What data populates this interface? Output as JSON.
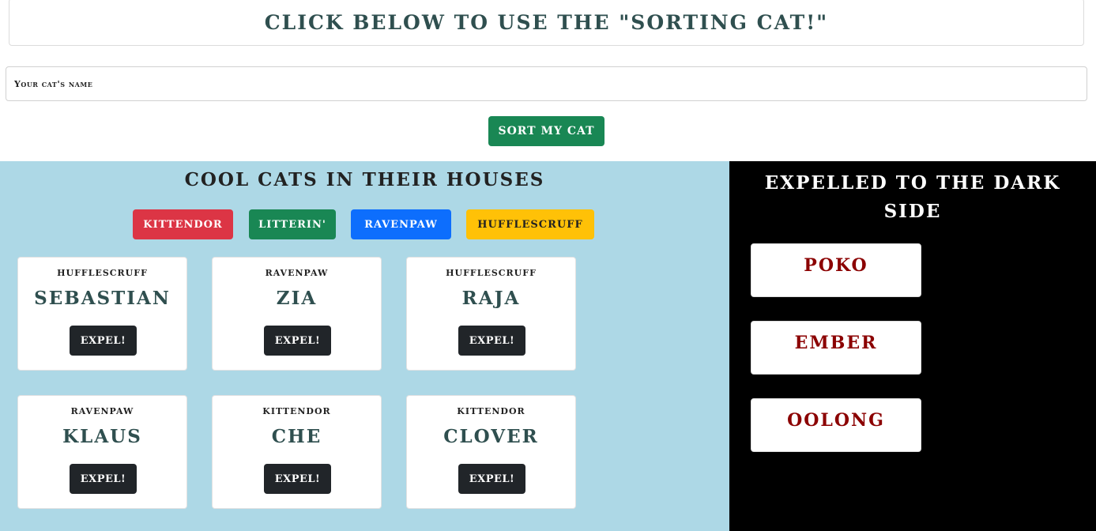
{
  "banner": {
    "title": "Click below to use the \"Sorting Cat!\""
  },
  "form": {
    "name_placeholder": "Your cat's name",
    "sort_label": "Sort my cat"
  },
  "houses": {
    "title": "Cool cats in their houses",
    "filters": [
      {
        "label": "Kittendor",
        "color": "#dc3545"
      },
      {
        "label": "Litterin'",
        "color": "#198754"
      },
      {
        "label": "Ravenpaw",
        "color": "#0d6efd"
      },
      {
        "label": "Hufflescruff",
        "color": "#ffc107"
      }
    ],
    "cats": [
      {
        "house": "Hufflescruff",
        "name": "Sebastian",
        "action": "Expel!"
      },
      {
        "house": "Ravenpaw",
        "name": "Zia",
        "action": "Expel!"
      },
      {
        "house": "Hufflescruff",
        "name": "Raja",
        "action": "Expel!"
      },
      {
        "house": "Ravenpaw",
        "name": "Klaus",
        "action": "Expel!"
      },
      {
        "house": "Kittendor",
        "name": "Che",
        "action": "Expel!"
      },
      {
        "house": "Kittendor",
        "name": "Clover",
        "action": "Expel!"
      }
    ]
  },
  "dark_side": {
    "title": "Expelled to the dark side",
    "expelled": [
      {
        "name": "Poko"
      },
      {
        "name": "Ember"
      },
      {
        "name": "Oolong"
      }
    ]
  },
  "colors": {
    "houses_bg": "#add8e6",
    "dark_bg": "#000000",
    "expelled_text": "#8b0000",
    "heading_text": "#2f4f4f"
  }
}
